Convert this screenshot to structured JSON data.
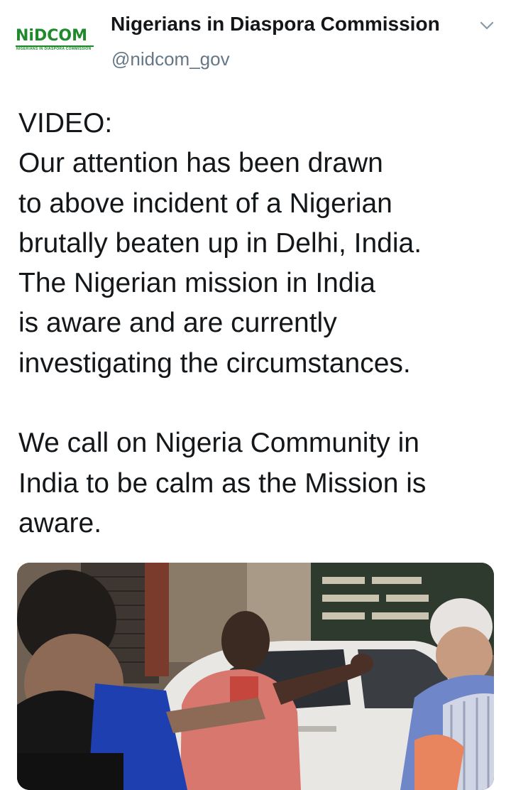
{
  "author": {
    "avatar_brand": "NiDCOM",
    "avatar_subtitle": "NIGERIANS IN DIASPORA COMMISSION",
    "display_name": "Nigerians in Diaspora Commission",
    "handle": "@nidcom_gov"
  },
  "tweet": {
    "lines": [
      "VIDEO:",
      "Our attention has been drawn",
      "to above incident of a Nigerian",
      "brutally beaten up in Delhi, India.",
      "The Nigerian mission in India",
      "is aware and are currently",
      "investigating the circumstances.",
      "",
      "We call on Nigeria Community in",
      "India to be calm as the Mission is",
      "aware."
    ]
  },
  "icons": {
    "menu": "chevron-down-icon"
  },
  "colors": {
    "text": "#14171a",
    "secondary": "#657786",
    "brand_green": "#1f8a2c"
  }
}
